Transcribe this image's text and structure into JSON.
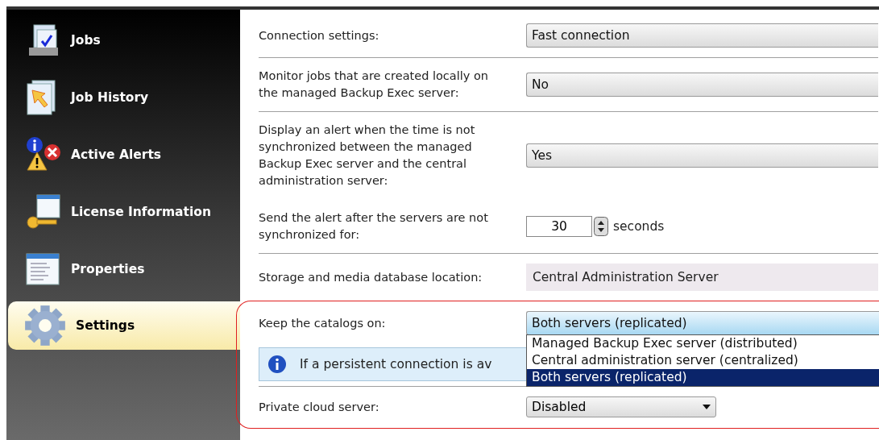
{
  "sidebar": {
    "items": [
      {
        "label": "Jobs",
        "kind": "jobs",
        "selected": false
      },
      {
        "label": "Job History",
        "kind": "history",
        "selected": false
      },
      {
        "label": "Active Alerts",
        "kind": "alerts",
        "selected": false
      },
      {
        "label": "License Information",
        "kind": "license",
        "selected": false
      },
      {
        "label": "Properties",
        "kind": "properties",
        "selected": false
      },
      {
        "label": "Settings",
        "kind": "settings",
        "selected": true
      }
    ]
  },
  "settings": [
    {
      "kind": "combo",
      "label": "Connection settings:",
      "value": "Fast connection",
      "divider": true
    },
    {
      "kind": "combo",
      "label": "Monitor jobs that are created locally on the managed Backup Exec server:",
      "value": "No",
      "divider": true
    },
    {
      "kind": "combo",
      "label": "Display an alert when the time is not synchronized between the managed Backup Exec server and the central administration server:",
      "value": "Yes",
      "divider": false
    },
    {
      "kind": "spinner",
      "label": "Send the alert after the servers are not synchronized for:",
      "value": "30",
      "unit": "seconds",
      "divider": true
    },
    {
      "kind": "readonly",
      "label": "Storage and media database location:",
      "value": "Central Administration Server",
      "divider": true
    }
  ],
  "highlighted_settings": [
    {
      "kind": "combo",
      "label": "Keep the catalogs on:",
      "value": "Both servers (replicated)",
      "divider": false,
      "open": true,
      "options": [
        {
          "label": "Managed Backup Exec server (distributed)",
          "selected": false
        },
        {
          "label": "Central administration server (centralized)",
          "selected": false
        },
        {
          "label": "Both servers (replicated)",
          "selected": true
        }
      ]
    },
    {
      "kind": "info",
      "text": "If a persistent connection is av",
      "divider": true
    },
    {
      "kind": "small-combo",
      "label": "Private cloud server:",
      "value": "Disabled",
      "divider": false
    }
  ]
}
